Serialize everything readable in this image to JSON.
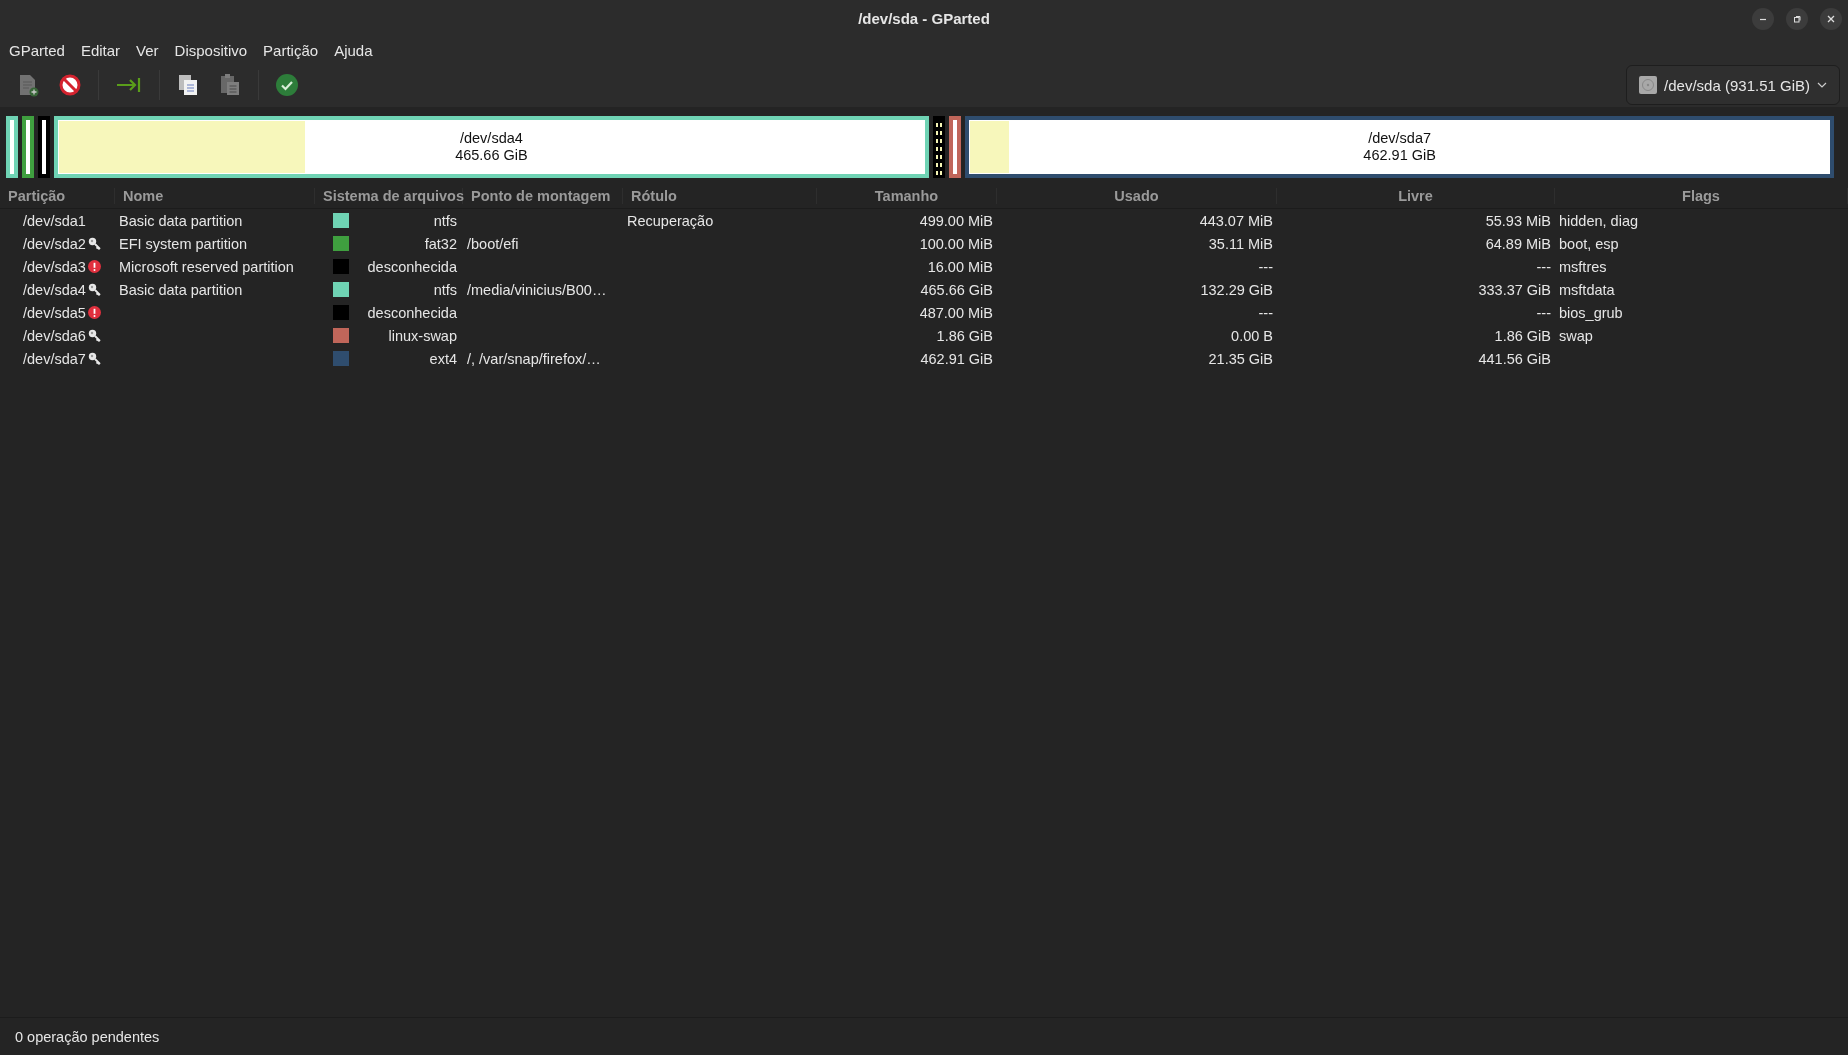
{
  "window": {
    "title": "/dev/sda - GParted"
  },
  "menu": [
    "GParted",
    "Editar",
    "Ver",
    "Dispositivo",
    "Partição",
    "Ajuda"
  ],
  "toolbar": [
    {
      "kind": "new",
      "disabled": true
    },
    {
      "kind": "delete",
      "disabled": false
    },
    {
      "kind": "resize",
      "disabled": false
    },
    {
      "kind": "copy",
      "disabled": false
    },
    {
      "kind": "paste",
      "disabled": true
    },
    {
      "kind": "apply",
      "disabled": false
    }
  ],
  "device_selector": {
    "label": "/dev/sda (931.51 GiB)"
  },
  "disk_map": [
    {
      "kind": "plain"
    },
    {
      "kind": "plain"
    },
    {
      "kind": "plain"
    },
    {
      "kind": "plain",
      "level": 0.284,
      "label": "/dev/sda4",
      "size": "465.66 GiB"
    },
    {
      "kind": "striped"
    },
    {
      "kind": "plain"
    },
    {
      "kind": "plain",
      "level": 0.046,
      "label": "/dev/sda7",
      "size": "462.91 GiB"
    }
  ],
  "table": {
    "columns": [
      "Partição",
      "Nome",
      "Sistema de arquivos",
      "Ponto de montagem",
      "Rótulo",
      "Tamanho",
      "Usado",
      "Livre",
      "Flags"
    ],
    "rows": [
      {
        "partition": "/dev/sda1",
        "kind": "plain",
        "name": "Basic data partition",
        "color": "#6fd3b4",
        "filesystem": "ntfs",
        "mount": "",
        "label": "Recuperação",
        "size": "499.00 MiB",
        "used": "443.07 MiB",
        "free": "55.93 MiB",
        "flags": "hidden, diag"
      },
      {
        "partition": "/dev/sda2",
        "kind": "mounted",
        "name": "EFI system partition",
        "color": "#3f9f3f",
        "filesystem": "fat32",
        "mount": "/boot/efi",
        "label": "",
        "size": "100.00 MiB",
        "used": "35.11 MiB",
        "free": "64.89 MiB",
        "flags": "boot, esp"
      },
      {
        "partition": "/dev/sda3",
        "kind": "warning",
        "name": "Microsoft reserved partition",
        "color": "#000000",
        "filesystem": "desconhecida",
        "mount": "",
        "label": "",
        "size": "16.00 MiB",
        "used": "---",
        "free": "---",
        "flags": "msftres"
      },
      {
        "partition": "/dev/sda4",
        "kind": "mounted",
        "name": "Basic data partition",
        "color": "#6fd3b4",
        "filesystem": "ntfs",
        "mount": "/media/vinicius/B00…",
        "label": "",
        "size": "465.66 GiB",
        "used": "132.29 GiB",
        "free": "333.37 GiB",
        "flags": "msftdata"
      },
      {
        "partition": "/dev/sda5",
        "kind": "warning",
        "name": "",
        "color": "#000000",
        "filesystem": "desconhecida",
        "mount": "",
        "label": "",
        "size": "487.00 MiB",
        "used": "---",
        "free": "---",
        "flags": "bios_grub"
      },
      {
        "partition": "/dev/sda6",
        "kind": "mounted",
        "name": "",
        "color": "#c0665a",
        "filesystem": "linux-swap",
        "mount": "",
        "label": "",
        "size": "1.86 GiB",
        "used": "0.00 B",
        "free": "1.86 GiB",
        "flags": "swap"
      },
      {
        "partition": "/dev/sda7",
        "kind": "mounted",
        "name": "",
        "color": "#2f4d6e",
        "filesystem": "ext4",
        "mount": "/, /var/snap/firefox/…",
        "label": "",
        "size": "462.91 GiB",
        "used": "21.35 GiB",
        "free": "441.56 GiB",
        "flags": ""
      }
    ]
  },
  "status_bar": {
    "text": "0 operação pendentes"
  }
}
